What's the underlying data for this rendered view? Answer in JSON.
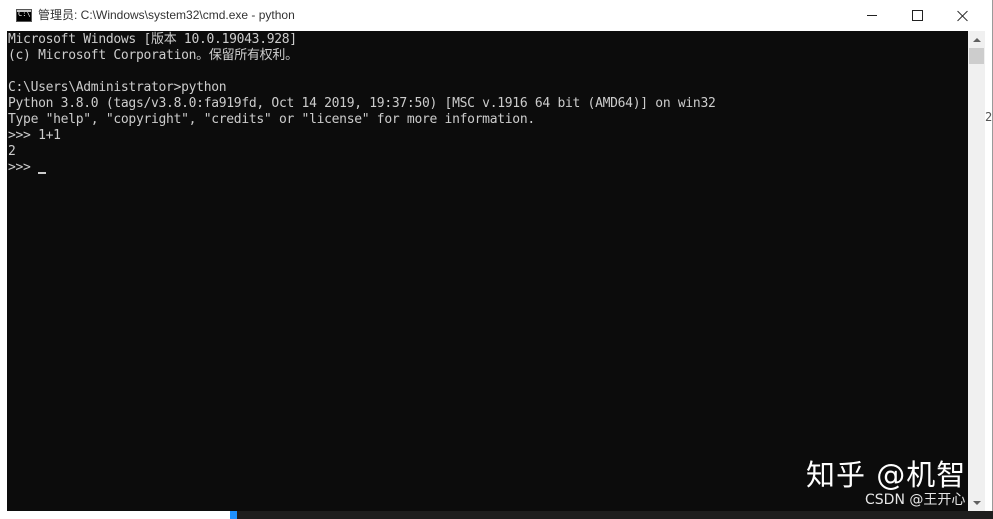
{
  "window": {
    "title": "管理员: C:\\Windows\\system32\\cmd.exe - python",
    "icon": "cmd-icon",
    "buttons": {
      "minimize": "minimize-icon",
      "maximize": "maximize-icon",
      "close": "close-icon"
    }
  },
  "console": {
    "background": "#0c0c0c",
    "foreground": "#cccccc",
    "lines": [
      "Microsoft Windows [版本 10.0.19043.928]",
      "(c) Microsoft Corporation。保留所有权利。",
      "",
      "C:\\Users\\Administrator>python",
      "Python 3.8.0 (tags/v3.8.0:fa919fd, Oct 14 2019, 19:37:50) [MSC v.1916 64 bit (AMD64)] on win32",
      "Type \"help\", \"copyright\", \"credits\" or \"license\" for more information.",
      ">>> 1+1",
      "2",
      ">>> "
    ]
  },
  "edge_text": "2",
  "watermark": {
    "main": "知乎 @机智",
    "sub": "CSDN @王开心"
  }
}
